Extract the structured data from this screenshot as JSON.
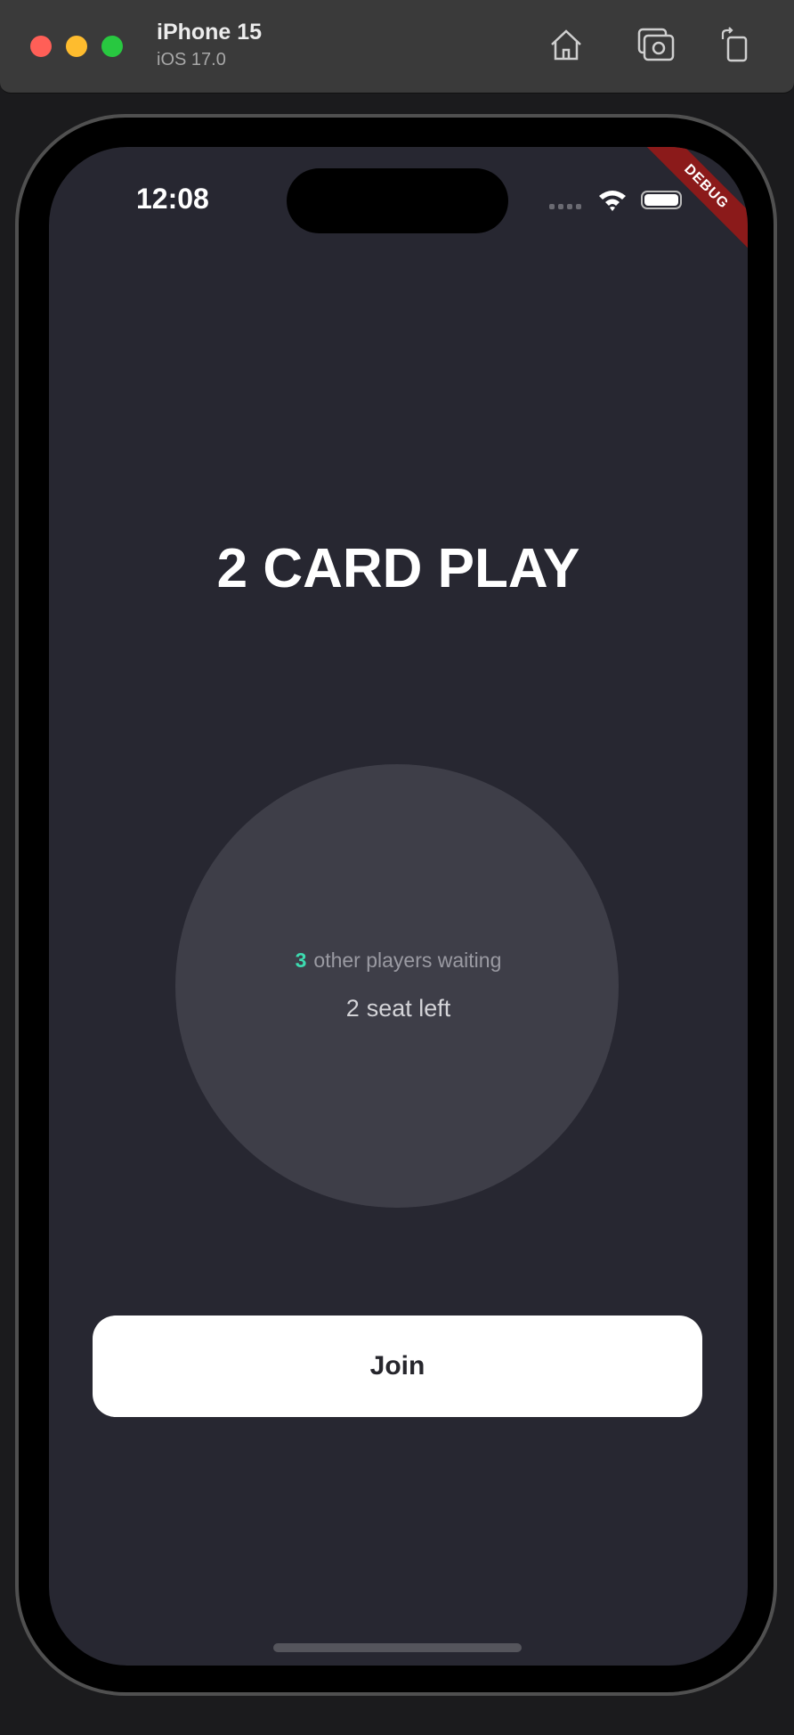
{
  "simulator": {
    "device_name": "iPhone 15",
    "os_version": "iOS 17.0",
    "window_controls": {
      "close_color": "#ff5f57",
      "minimize_color": "#febc2e",
      "zoom_color": "#28c840"
    },
    "toolbar_icons": [
      "home-icon",
      "screenshot-icon",
      "rotate-icon"
    ]
  },
  "status_bar": {
    "time": "12:08",
    "debug_banner": "DEBUG"
  },
  "app": {
    "title": "2 CARD PLAY",
    "waiting_count": "3",
    "waiting_label": "other players waiting",
    "seats_count": "2",
    "seats_label": "seat left",
    "join_label": "Join",
    "accent_color": "#3ddbb0"
  }
}
